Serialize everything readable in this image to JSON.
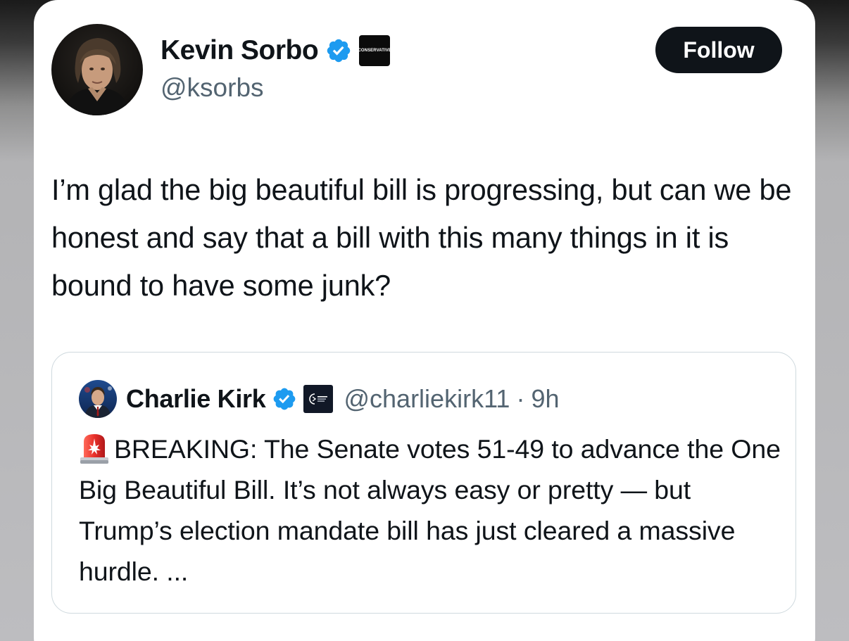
{
  "tweet": {
    "author_name": "Kevin Sorbo",
    "author_handle": "@ksorbs",
    "verified_icon": "verified-badge-icon",
    "affiliation_badge_text": "CONSERVATIVE",
    "follow_label": "Follow",
    "text": "I’m glad the big beautiful bill is progressing, but can we be honest and say that a bill with this many things in it is bound to have some junk?"
  },
  "quoted_tweet": {
    "author_name": "Charlie Kirk",
    "author_handle": "@charliekirk11",
    "separator": "·",
    "time": "9h",
    "verified_icon": "verified-badge-icon",
    "affiliation_icon": "organization-logo-icon",
    "emoji_icon": "police-light-icon",
    "text": "BREAKING: The Senate votes 51-49 to advance the One Big Beautiful Bill. It’s not always easy or pretty — but Trump’s election mandate bill has just cleared a massive hurdle. ..."
  },
  "colors": {
    "verified_blue": "#1d9bf0",
    "text_primary": "#0f1419",
    "text_secondary": "#536471",
    "follow_button_bg": "#0f1419",
    "border": "#cfd9de"
  }
}
